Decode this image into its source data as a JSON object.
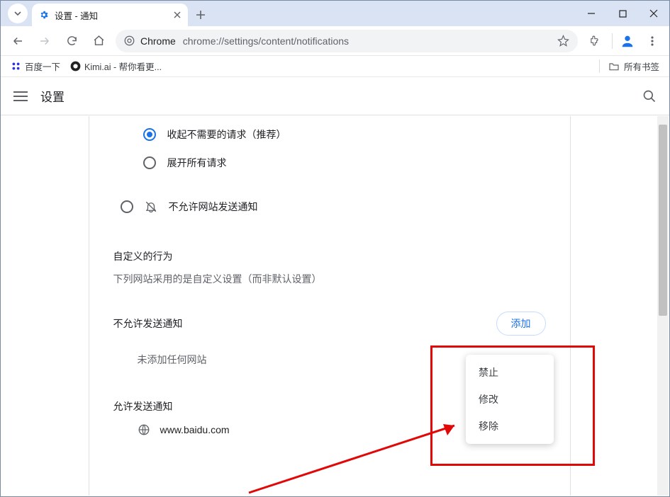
{
  "window": {
    "tab_title": "设置 - 通知",
    "minimize": "—",
    "maximize": "☐",
    "close": "✕"
  },
  "toolbar": {
    "chrome_label": "Chrome",
    "url": "chrome://settings/content/notifications"
  },
  "bookmarks": {
    "item1": "百度一下",
    "item2": "Kimi.ai - 帮你看更...",
    "all": "所有书签"
  },
  "settings_header": {
    "title": "设置"
  },
  "content": {
    "radio_collapse": "收起不需要的请求（推荐）",
    "radio_expand": "展开所有请求",
    "radio_block_all": "不允许网站发送通知",
    "custom_label": "自定义的行为",
    "custom_desc": "下列网站采用的是自定义设置（而非默认设置）",
    "block_section": "不允许发送通知",
    "add_btn": "添加",
    "empty_text": "未添加任何网站",
    "allow_section": "允许发送通知",
    "site1": "www.baidu.com"
  },
  "context_menu": {
    "item_block": "禁止",
    "item_edit": "修改",
    "item_remove": "移除"
  }
}
